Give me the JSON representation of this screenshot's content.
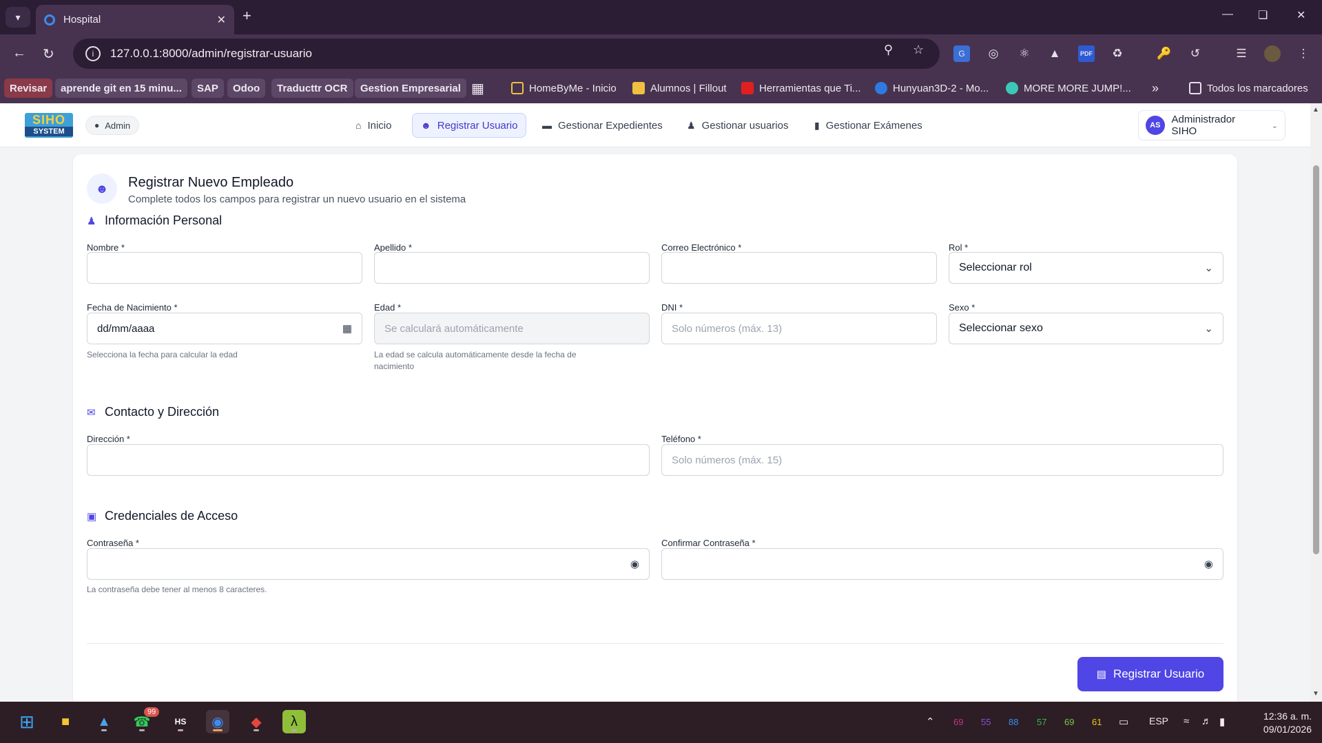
{
  "browser": {
    "tab_title": "Hospital",
    "url": "127.0.0.1:8000/admin/registrar-usuario",
    "bookmarks": [
      "Revisar",
      "aprende git en 15 minu...",
      "SAP",
      "Odoo",
      "Traducttr OCR",
      "Gestion Empresarial",
      "HomeByMe - Inicio",
      "Alumnos | Fillout",
      "Herramientas que Ti...",
      "Hunyuan3D-2 - Mo...",
      "MORE MORE JUMP!...",
      "Todos los marcadores"
    ],
    "overflow_glyph": "»"
  },
  "app": {
    "logo_top": "SIHO",
    "logo_bottom": "SYSTEM",
    "role_badge": "Admin",
    "nav": [
      "Inicio",
      "Registrar Usuario",
      "Gestionar Expedientes",
      "Gestionar usuarios",
      "Gestionar Exámenes"
    ],
    "user_initials": "AS",
    "user_name": "Administrador SIHO"
  },
  "form": {
    "title": "Registrar Nuevo Empleado",
    "subtitle": "Complete todos los campos para registrar un nuevo usuario en el sistema",
    "sections": {
      "personal": "Información Personal",
      "contact": "Contacto y Dirección",
      "credentials": "Credenciales de Acceso"
    },
    "labels": {
      "nombre": "Nombre *",
      "apellido": "Apellido *",
      "correo": "Correo Electrónico *",
      "rol": "Rol *",
      "fecha": "Fecha de Nacimiento *",
      "edad": "Edad *",
      "dni": "DNI *",
      "sexo": "Sexo *",
      "direccion": "Dirección *",
      "telefono": "Teléfono *",
      "password": "Contraseña *",
      "confirm": "Confirmar Contraseña *"
    },
    "values": {
      "rol": "Seleccionar rol",
      "fecha": "dd/mm/aaaa",
      "sexo": "Seleccionar sexo"
    },
    "placeholders": {
      "edad": "Se calculará automáticamente",
      "dni": "Solo números (máx. 13)",
      "telefono": "Solo números (máx. 15)"
    },
    "help": {
      "fecha": "Selecciona la fecha para calcular la edad",
      "edad_1": "La edad se calcula automáticamente desde la fecha de",
      "edad_2": "nacimiento",
      "password": "La contraseña debe tener al menos 8 caracteres."
    },
    "submit": "Registrar Usuario"
  },
  "taskbar": {
    "whatsapp_badge": "99",
    "tray_numbers": [
      "69",
      "55",
      "88",
      "57",
      "69",
      "61"
    ],
    "tray_colors": [
      "#c5318a",
      "#8a4fd8",
      "#3b8ef0",
      "#38b84a",
      "#7ac943",
      "#f0c419"
    ],
    "language": "ESP",
    "time": "12:36 a. m.",
    "date": "09/01/2026"
  }
}
